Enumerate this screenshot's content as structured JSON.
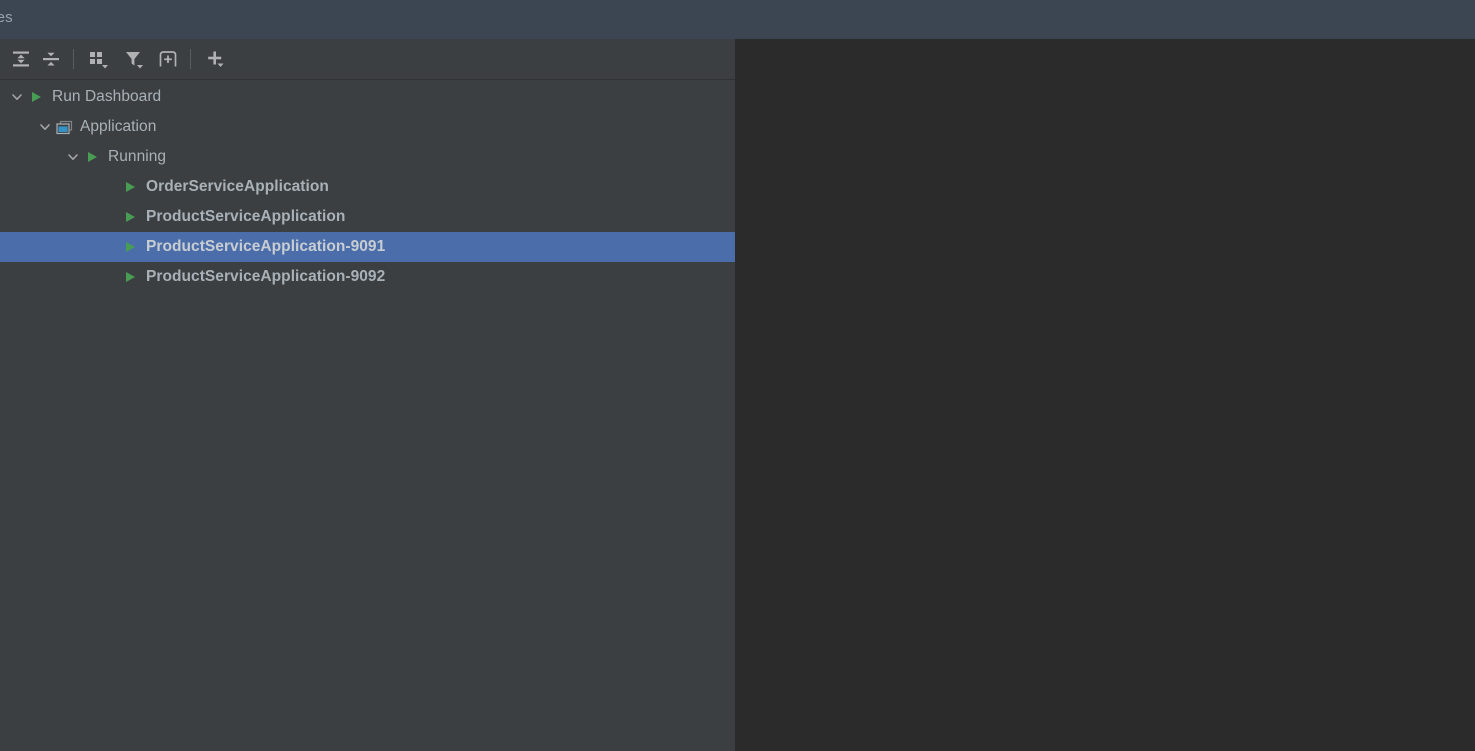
{
  "window": {
    "title_tab": "vices",
    "background": "#2b2b2b",
    "titlebar_color": "#3c4552",
    "panel_color": "#3c3f41",
    "selection_color": "#4b6eab",
    "run_green": "#499c54",
    "icon_grey": "#afb1b3"
  },
  "toolbar": {
    "buttons": [
      {
        "name": "expand-all-icon",
        "tooltip": "Expand All",
        "has_dropdown": false
      },
      {
        "name": "collapse-all-icon",
        "tooltip": "Collapse All",
        "has_dropdown": false
      },
      {
        "name": "group-by-icon",
        "tooltip": "Group By",
        "has_dropdown": true
      },
      {
        "name": "filter-icon",
        "tooltip": "Filter",
        "has_dropdown": true
      },
      {
        "name": "new-frame-icon",
        "tooltip": "Open in New Window",
        "has_dropdown": false
      },
      {
        "name": "add-service-icon",
        "tooltip": "Add Service",
        "has_dropdown": true
      }
    ]
  },
  "tree": {
    "nodes": [
      {
        "label": "Run Dashboard",
        "level": 0,
        "icon": "run-green-triangle",
        "expanded": true,
        "bold": false,
        "selected": false
      },
      {
        "label": "Application",
        "level": 1,
        "icon": "application-window",
        "expanded": true,
        "bold": false,
        "selected": false
      },
      {
        "label": "Running",
        "level": 2,
        "icon": "run-green-triangle",
        "expanded": true,
        "bold": false,
        "selected": false
      },
      {
        "label": "OrderServiceApplication",
        "level": 3,
        "icon": "run-green-triangle",
        "expanded": null,
        "bold": true,
        "selected": false
      },
      {
        "label": "ProductServiceApplication",
        "level": 3,
        "icon": "run-green-triangle",
        "expanded": null,
        "bold": true,
        "selected": false
      },
      {
        "label": "ProductServiceApplication-9091",
        "level": 3,
        "icon": "run-green-triangle",
        "expanded": null,
        "bold": true,
        "selected": true
      },
      {
        "label": "ProductServiceApplication-9092",
        "level": 3,
        "icon": "run-green-triangle",
        "expanded": null,
        "bold": true,
        "selected": false
      }
    ]
  }
}
